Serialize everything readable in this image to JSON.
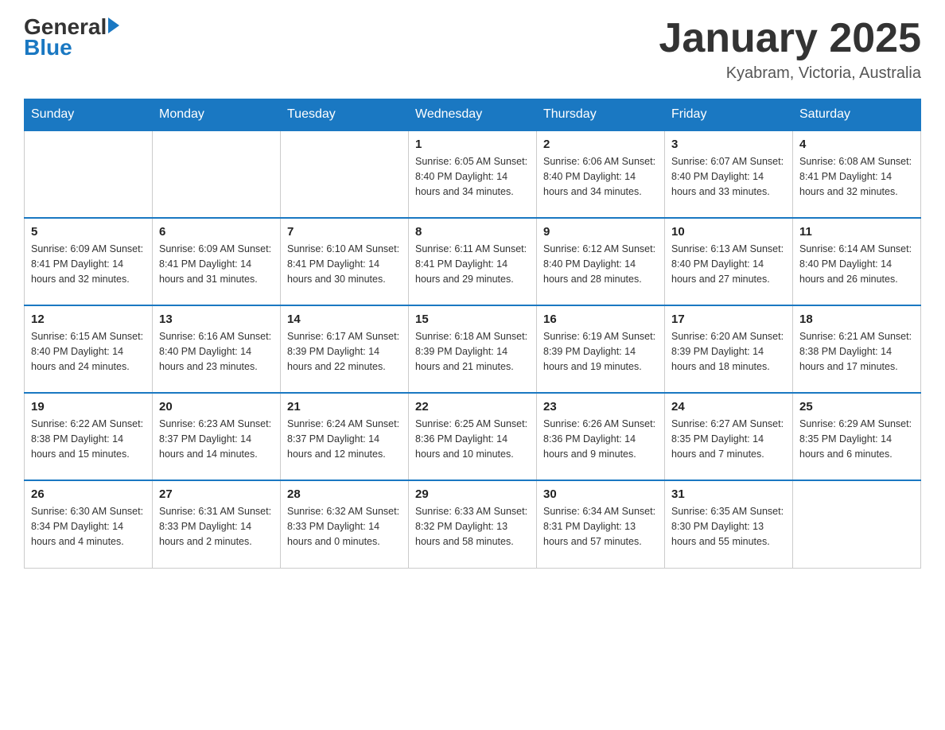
{
  "header": {
    "logo_general": "General",
    "logo_blue": "Blue",
    "month_title": "January 2025",
    "location": "Kyabram, Victoria, Australia"
  },
  "days_of_week": [
    "Sunday",
    "Monday",
    "Tuesday",
    "Wednesday",
    "Thursday",
    "Friday",
    "Saturday"
  ],
  "weeks": [
    [
      {
        "day": "",
        "info": ""
      },
      {
        "day": "",
        "info": ""
      },
      {
        "day": "",
        "info": ""
      },
      {
        "day": "1",
        "info": "Sunrise: 6:05 AM\nSunset: 8:40 PM\nDaylight: 14 hours and 34 minutes."
      },
      {
        "day": "2",
        "info": "Sunrise: 6:06 AM\nSunset: 8:40 PM\nDaylight: 14 hours and 34 minutes."
      },
      {
        "day": "3",
        "info": "Sunrise: 6:07 AM\nSunset: 8:40 PM\nDaylight: 14 hours and 33 minutes."
      },
      {
        "day": "4",
        "info": "Sunrise: 6:08 AM\nSunset: 8:41 PM\nDaylight: 14 hours and 32 minutes."
      }
    ],
    [
      {
        "day": "5",
        "info": "Sunrise: 6:09 AM\nSunset: 8:41 PM\nDaylight: 14 hours and 32 minutes."
      },
      {
        "day": "6",
        "info": "Sunrise: 6:09 AM\nSunset: 8:41 PM\nDaylight: 14 hours and 31 minutes."
      },
      {
        "day": "7",
        "info": "Sunrise: 6:10 AM\nSunset: 8:41 PM\nDaylight: 14 hours and 30 minutes."
      },
      {
        "day": "8",
        "info": "Sunrise: 6:11 AM\nSunset: 8:41 PM\nDaylight: 14 hours and 29 minutes."
      },
      {
        "day": "9",
        "info": "Sunrise: 6:12 AM\nSunset: 8:40 PM\nDaylight: 14 hours and 28 minutes."
      },
      {
        "day": "10",
        "info": "Sunrise: 6:13 AM\nSunset: 8:40 PM\nDaylight: 14 hours and 27 minutes."
      },
      {
        "day": "11",
        "info": "Sunrise: 6:14 AM\nSunset: 8:40 PM\nDaylight: 14 hours and 26 minutes."
      }
    ],
    [
      {
        "day": "12",
        "info": "Sunrise: 6:15 AM\nSunset: 8:40 PM\nDaylight: 14 hours and 24 minutes."
      },
      {
        "day": "13",
        "info": "Sunrise: 6:16 AM\nSunset: 8:40 PM\nDaylight: 14 hours and 23 minutes."
      },
      {
        "day": "14",
        "info": "Sunrise: 6:17 AM\nSunset: 8:39 PM\nDaylight: 14 hours and 22 minutes."
      },
      {
        "day": "15",
        "info": "Sunrise: 6:18 AM\nSunset: 8:39 PM\nDaylight: 14 hours and 21 minutes."
      },
      {
        "day": "16",
        "info": "Sunrise: 6:19 AM\nSunset: 8:39 PM\nDaylight: 14 hours and 19 minutes."
      },
      {
        "day": "17",
        "info": "Sunrise: 6:20 AM\nSunset: 8:39 PM\nDaylight: 14 hours and 18 minutes."
      },
      {
        "day": "18",
        "info": "Sunrise: 6:21 AM\nSunset: 8:38 PM\nDaylight: 14 hours and 17 minutes."
      }
    ],
    [
      {
        "day": "19",
        "info": "Sunrise: 6:22 AM\nSunset: 8:38 PM\nDaylight: 14 hours and 15 minutes."
      },
      {
        "day": "20",
        "info": "Sunrise: 6:23 AM\nSunset: 8:37 PM\nDaylight: 14 hours and 14 minutes."
      },
      {
        "day": "21",
        "info": "Sunrise: 6:24 AM\nSunset: 8:37 PM\nDaylight: 14 hours and 12 minutes."
      },
      {
        "day": "22",
        "info": "Sunrise: 6:25 AM\nSunset: 8:36 PM\nDaylight: 14 hours and 10 minutes."
      },
      {
        "day": "23",
        "info": "Sunrise: 6:26 AM\nSunset: 8:36 PM\nDaylight: 14 hours and 9 minutes."
      },
      {
        "day": "24",
        "info": "Sunrise: 6:27 AM\nSunset: 8:35 PM\nDaylight: 14 hours and 7 minutes."
      },
      {
        "day": "25",
        "info": "Sunrise: 6:29 AM\nSunset: 8:35 PM\nDaylight: 14 hours and 6 minutes."
      }
    ],
    [
      {
        "day": "26",
        "info": "Sunrise: 6:30 AM\nSunset: 8:34 PM\nDaylight: 14 hours and 4 minutes."
      },
      {
        "day": "27",
        "info": "Sunrise: 6:31 AM\nSunset: 8:33 PM\nDaylight: 14 hours and 2 minutes."
      },
      {
        "day": "28",
        "info": "Sunrise: 6:32 AM\nSunset: 8:33 PM\nDaylight: 14 hours and 0 minutes."
      },
      {
        "day": "29",
        "info": "Sunrise: 6:33 AM\nSunset: 8:32 PM\nDaylight: 13 hours and 58 minutes."
      },
      {
        "day": "30",
        "info": "Sunrise: 6:34 AM\nSunset: 8:31 PM\nDaylight: 13 hours and 57 minutes."
      },
      {
        "day": "31",
        "info": "Sunrise: 6:35 AM\nSunset: 8:30 PM\nDaylight: 13 hours and 55 minutes."
      },
      {
        "day": "",
        "info": ""
      }
    ]
  ]
}
